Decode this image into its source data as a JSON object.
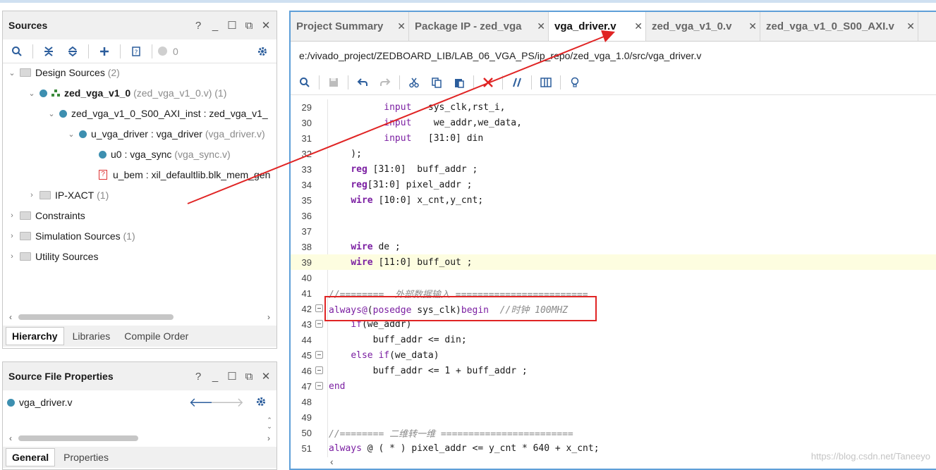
{
  "sources_panel": {
    "title": "Sources",
    "ctrl_help": "?",
    "ctrl_min": "_",
    "ctrl_restore": "☐",
    "ctrl_float": "⧉",
    "ctrl_close": "✕",
    "toolbar": {
      "count": "0"
    },
    "tree": {
      "design_sources": {
        "label": "Design Sources",
        "count": "(2)"
      },
      "zed_vga": {
        "label": "zed_vga_v1_0",
        "detail": "(zed_vga_v1_0.v) (1)"
      },
      "s00_inst": {
        "label": "zed_vga_v1_0_S00_AXI_inst : zed_vga_v1_"
      },
      "u_vga_driver": {
        "label": "u_vga_driver : vga_driver",
        "detail": "(vga_driver.v)"
      },
      "u0": {
        "label": "u0 : vga_sync",
        "detail": "(vga_sync.v)"
      },
      "u_bem": {
        "label": "u_bem : xil_defaultlib.blk_mem_gen"
      },
      "ipxact": {
        "label": "IP-XACT",
        "count": "(1)"
      },
      "constraints": {
        "label": "Constraints"
      },
      "sim_sources": {
        "label": "Simulation Sources",
        "count": "(1)"
      },
      "utility_sources": {
        "label": "Utility Sources"
      }
    },
    "tabs": [
      "Hierarchy",
      "Libraries",
      "Compile Order"
    ]
  },
  "props_panel": {
    "title": "Source File Properties",
    "file": "vga_driver.v",
    "tabs": [
      "General",
      "Properties"
    ]
  },
  "editor": {
    "tabs": [
      {
        "label": "Project Summary"
      },
      {
        "label": "Package IP - zed_vga"
      },
      {
        "label": "vga_driver.v"
      },
      {
        "label": "zed_vga_v1_0.v"
      },
      {
        "label": "zed_vga_v1_0_S00_AXI.v"
      }
    ],
    "path": "e:/vivado_project/ZEDBOARD_LIB/LAB_06_VGA_PS/ip_repo/zed_vga_1.0/src/vga_driver.v",
    "lines": [
      {
        "n": "29",
        "parts": [
          [
            "pl",
            "          "
          ],
          [
            "kw2",
            "input"
          ],
          [
            "pl",
            "   sys_clk,rst_i,"
          ]
        ]
      },
      {
        "n": "30",
        "parts": [
          [
            "pl",
            "          "
          ],
          [
            "kw2",
            "input"
          ],
          [
            "pl",
            "    we_addr,we_data,"
          ]
        ]
      },
      {
        "n": "31",
        "parts": [
          [
            "pl",
            "          "
          ],
          [
            "kw2",
            "input"
          ],
          [
            "pl",
            "   [31:0] din"
          ]
        ]
      },
      {
        "n": "32",
        "parts": [
          [
            "pl",
            "    );"
          ]
        ]
      },
      {
        "n": "33",
        "parts": [
          [
            "pl",
            "    "
          ],
          [
            "kw",
            "reg"
          ],
          [
            "pl",
            " [31:0]  buff_addr ;"
          ]
        ]
      },
      {
        "n": "34",
        "parts": [
          [
            "pl",
            "    "
          ],
          [
            "kw",
            "reg"
          ],
          [
            "pl",
            "[31:0] pixel_addr ;"
          ]
        ]
      },
      {
        "n": "35",
        "parts": [
          [
            "pl",
            "    "
          ],
          [
            "kw",
            "wire"
          ],
          [
            "pl",
            " [10:0] x_cnt,y_cnt;"
          ]
        ]
      },
      {
        "n": "36",
        "parts": []
      },
      {
        "n": "37",
        "parts": []
      },
      {
        "n": "38",
        "parts": [
          [
            "pl",
            "    "
          ],
          [
            "kw",
            "wire"
          ],
          [
            "pl",
            " de ;"
          ]
        ]
      },
      {
        "n": "39",
        "parts": [
          [
            "pl",
            "    "
          ],
          [
            "kw",
            "wire"
          ],
          [
            "pl",
            " [11:0] buff_out ;"
          ]
        ]
      },
      {
        "n": "40",
        "parts": []
      },
      {
        "n": "41",
        "parts": [
          [
            "cm",
            "//========  外部数据输入 ========================"
          ]
        ]
      },
      {
        "n": "42",
        "parts": [
          [
            "kw2",
            "always"
          ],
          [
            "kw2",
            "@"
          ],
          [
            "pl",
            "("
          ],
          [
            "kw2",
            "posedge"
          ],
          [
            "pl",
            " sys_clk)"
          ],
          [
            "kw2",
            "begin"
          ],
          [
            "pl",
            "  "
          ],
          [
            "cm",
            "//时钟 100MHZ"
          ]
        ]
      },
      {
        "n": "43",
        "parts": [
          [
            "pl",
            "    "
          ],
          [
            "kw2",
            "if"
          ],
          [
            "pl",
            "(we_addr)"
          ]
        ]
      },
      {
        "n": "44",
        "parts": [
          [
            "pl",
            "        buff_addr <= din;"
          ]
        ]
      },
      {
        "n": "45",
        "parts": [
          [
            "pl",
            "    "
          ],
          [
            "kw2",
            "else if"
          ],
          [
            "pl",
            "(we_data)"
          ]
        ]
      },
      {
        "n": "46",
        "parts": [
          [
            "pl",
            "        buff_addr <= 1 + buff_addr ;"
          ]
        ]
      },
      {
        "n": "47",
        "parts": [
          [
            "kw2",
            "end"
          ]
        ]
      },
      {
        "n": "48",
        "parts": []
      },
      {
        "n": "49",
        "parts": []
      },
      {
        "n": "50",
        "parts": [
          [
            "cm",
            "//======== 二维转一维 ========================"
          ]
        ]
      },
      {
        "n": "51",
        "parts": [
          [
            "kw2",
            "always"
          ],
          [
            "pl",
            " @ ( * ) pixel_addr <= y_cnt * 640 + x_cnt;"
          ]
        ]
      }
    ]
  },
  "watermark": "https://blog.csdn.net/Taneeyo"
}
